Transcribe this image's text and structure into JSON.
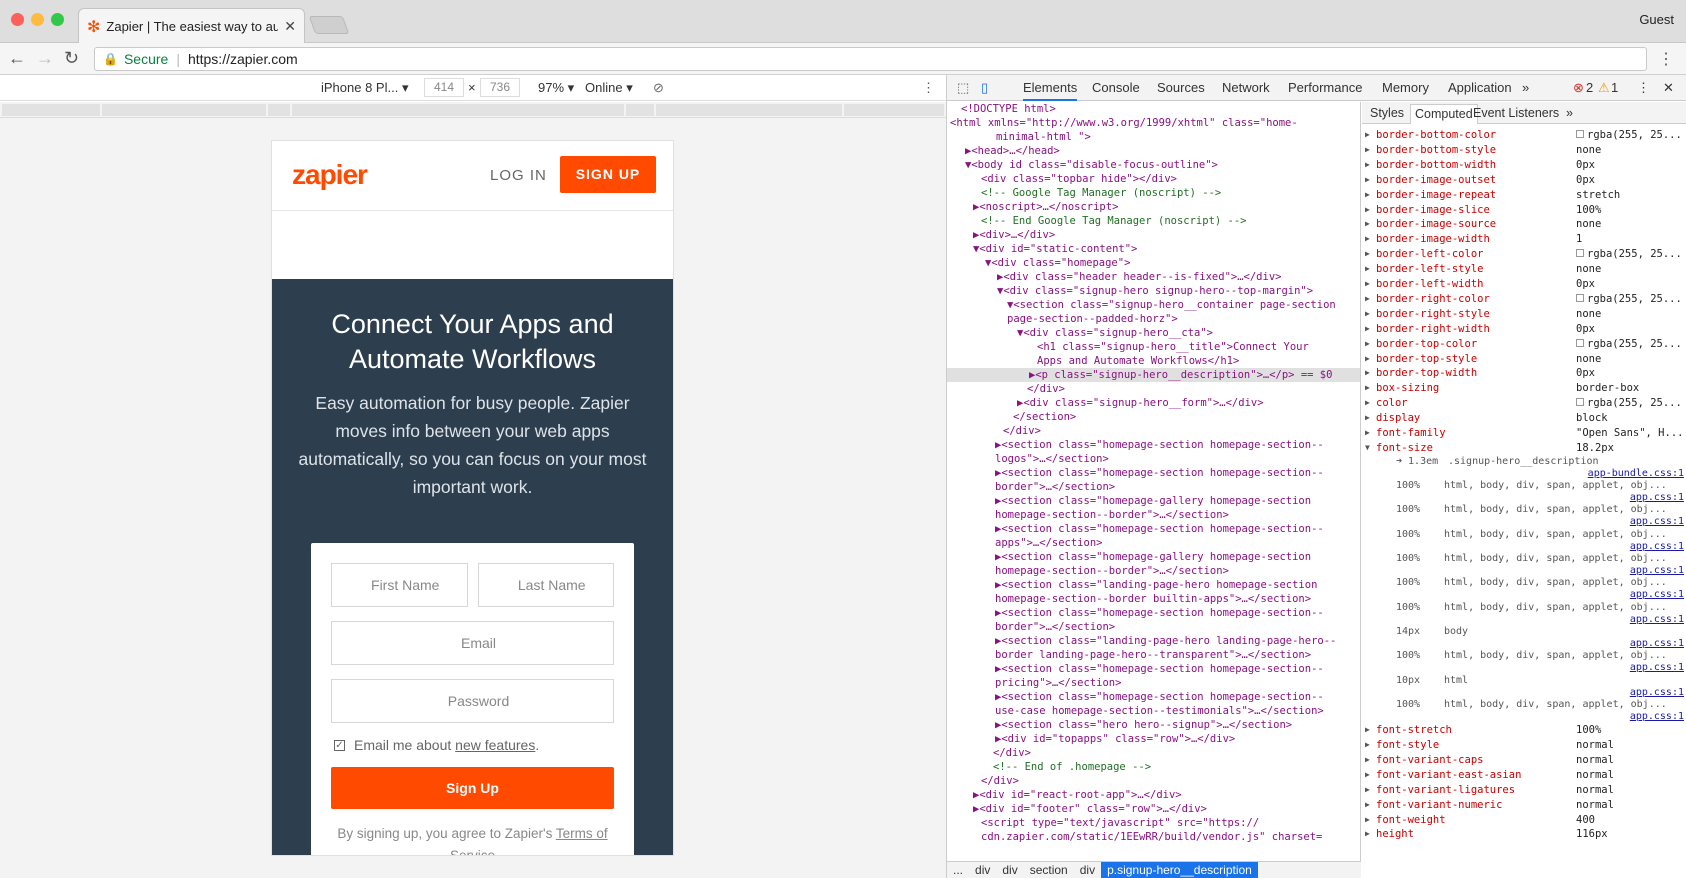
{
  "browser": {
    "tab_title": "Zapier | The easiest way to aut",
    "guest": "Guest",
    "secure": "Secure",
    "url": "https://zapier.com"
  },
  "device": {
    "model": "iPhone 8 Pl...",
    "width": "414",
    "height": "736",
    "times": "×",
    "zoom": "97%",
    "network": "Online"
  },
  "page": {
    "logo": "zapier",
    "login": "LOG IN",
    "signup": "SIGN UP",
    "hero_title": "Connect Your Apps and Automate Workflows",
    "hero_desc": "Easy automation for busy people. Zapier moves info between your web apps automatically, so you can focus on your most important work.",
    "first_name": "First Name",
    "last_name": "Last Name",
    "email": "Email",
    "password": "Password",
    "check_text": "Email me about ",
    "check_link": "new features",
    "check_end": ".",
    "submit": "Sign Up",
    "terms_text": "By signing up, you agree to Zapier's ",
    "terms_link": "Terms of Service"
  },
  "devtools": {
    "tabs": [
      "Elements",
      "Console",
      "Sources",
      "Network",
      "Performance",
      "Memory",
      "Application",
      "»"
    ],
    "errors": "2",
    "warnings": "1",
    "style_tabs": [
      "Styles",
      "Computed",
      "Event Listeners",
      "»"
    ],
    "crumbs": [
      "...",
      "div",
      "div",
      "section",
      "div",
      "p.signup-hero__description"
    ],
    "dom_lines": [
      "<!DOCTYPE html>",
      "<html xmlns=\"http://www.w3.org/1999/xhtml\" class=\"home-",
      "minimal-html \">",
      "▶<head>…</head>",
      "▼<body id class=\"disable-focus-outline\">",
      "<div class=\"topbar hide\"></div>",
      "<!-- Google Tag Manager (noscript) -->",
      "▶<noscript>…</noscript>",
      "<!-- End Google Tag Manager (noscript) -->",
      "▶<div>…</div>",
      "▼<div id=\"static-content\">",
      "▼<div class=\"homepage\">",
      "▶<div class=\"header header--is-fixed\">…</div>",
      "▼<div class=\"signup-hero signup-hero--top-margin\">",
      "▼<section class=\"signup-hero__container page-section",
      "page-section--padded-horz\">",
      "▼<div class=\"signup-hero__cta\">",
      "<h1 class=\"signup-hero__title\">Connect Your",
      "Apps and Automate Workflows</h1>",
      "▶<p class=\"signup-hero__description\">…</p> == $0",
      "</div>",
      "▶<div class=\"signup-hero__form\">…</div>",
      "</section>",
      "</div>",
      "▶<section class=\"homepage-section homepage-section--",
      "logos\">…</section>",
      "▶<section class=\"homepage-section homepage-section--",
      "border\">…</section>",
      "▶<section class=\"homepage-gallery homepage-section",
      "homepage-section--border\">…</section>",
      "▶<section class=\"homepage-section homepage-section--",
      "apps\">…</section>",
      "▶<section class=\"homepage-gallery homepage-section",
      "homepage-section--border\">…</section>",
      "▶<section class=\"landing-page-hero homepage-section",
      "homepage-section--border builtin-apps\">…</section>",
      "▶<section class=\"homepage-section homepage-section--",
      "border\">…</section>",
      "▶<section class=\"landing-page-hero landing-page-hero--",
      "border landing-page-hero--transparent\">…</section>",
      "▶<section class=\"homepage-section homepage-section--",
      "pricing\">…</section>",
      "▶<section class=\"homepage-section homepage-section--",
      "use-case homepage-section--testimonials\">…</section>",
      "▶<section class=\"hero hero--signup\">…</section>",
      "▶<div id=\"topapps\" class=\"row\">…</div>",
      "</div>",
      "<!-- End of .homepage -->",
      "</div>",
      "▶<div id=\"react-root-app\">…</div>",
      "▶<div id=\"footer\" class=\"row\">…</div>",
      "<script type=\"text/javascript\" src=\"https://",
      "cdn.zapier.com/static/1EEwRR/build/vendor.js\" charset="
    ],
    "computed": [
      [
        "border-bottom-color",
        "rgba(255, 25..."
      ],
      [
        "border-bottom-style",
        "none"
      ],
      [
        "border-bottom-width",
        "0px"
      ],
      [
        "border-image-outset",
        "0px"
      ],
      [
        "border-image-repeat",
        "stretch"
      ],
      [
        "border-image-slice",
        "100%"
      ],
      [
        "border-image-source",
        "none"
      ],
      [
        "border-image-width",
        "1"
      ],
      [
        "border-left-color",
        "rgba(255, 25..."
      ],
      [
        "border-left-style",
        "none"
      ],
      [
        "border-left-width",
        "0px"
      ],
      [
        "border-right-color",
        "rgba(255, 25..."
      ],
      [
        "border-right-style",
        "none"
      ],
      [
        "border-right-width",
        "0px"
      ],
      [
        "border-top-color",
        "rgba(255, 25..."
      ],
      [
        "border-top-style",
        "none"
      ],
      [
        "border-top-width",
        "0px"
      ],
      [
        "box-sizing",
        "border-box"
      ],
      [
        "color",
        "rgba(255, 25..."
      ],
      [
        "display",
        "block"
      ],
      [
        "font-family",
        "\"Open Sans\", H..."
      ],
      [
        "font-size",
        "18.2px"
      ]
    ],
    "font_size_trace": [
      [
        "1.3em",
        ".signup-hero__description",
        "app-bundle.css:1"
      ],
      [
        "100%",
        "html, body, div, span, applet, obj...",
        "app.css:1"
      ],
      [
        "100%",
        "html, body, div, span, applet, obj...",
        "app.css:1"
      ],
      [
        "100%",
        "html, body, div, span, applet, obj...",
        "app.css:1"
      ],
      [
        "100%",
        "html, body, div, span, applet, obj...",
        "app.css:1"
      ],
      [
        "100%",
        "html, body, div, span, applet, obj...",
        "app.css:1"
      ],
      [
        "100%",
        "html, body, div, span, applet, obj...",
        "app.css:1"
      ],
      [
        "14px",
        "body",
        "app.css:1"
      ],
      [
        "100%",
        "html, body, div, span, applet, obj...",
        "app.css:1"
      ],
      [
        "10px",
        "html",
        "app.css:1"
      ],
      [
        "100%",
        "html, body, div, span, applet, obj...",
        "app.css:1"
      ]
    ],
    "computed2": [
      [
        "font-stretch",
        "100%"
      ],
      [
        "font-style",
        "normal"
      ],
      [
        "font-variant-caps",
        "normal"
      ],
      [
        "font-variant-east-asian",
        "normal"
      ],
      [
        "font-variant-ligatures",
        "normal"
      ],
      [
        "font-variant-numeric",
        "normal"
      ],
      [
        "font-weight",
        "400"
      ],
      [
        "height",
        "116px"
      ]
    ]
  }
}
